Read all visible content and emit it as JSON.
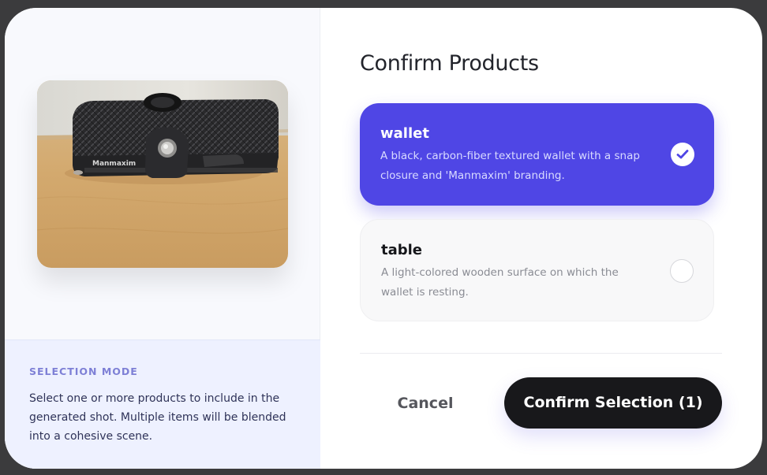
{
  "left": {
    "photo_brand_text": "Manmaxim",
    "mode_title": "SELECTION MODE",
    "mode_text": "Select one or more products to include in the generated shot. Multiple items will be blended into a cohesive scene."
  },
  "main": {
    "heading": "Confirm Products",
    "products": [
      {
        "name": "wallet",
        "description": "A black, carbon-fiber textured wallet with a snap closure and 'Manmaxim' branding.",
        "selected": true
      },
      {
        "name": "table",
        "description": "A light-colored wooden surface on which the wallet is resting.",
        "selected": false
      }
    ],
    "cancel_label": "Cancel",
    "confirm_label": "Confirm Selection (1)"
  },
  "colors": {
    "accent": "#4f46e5",
    "confirm_button": "#18181b",
    "mode_panel": "#eef1ff"
  },
  "icons": {
    "selected_check": "check-icon",
    "unselected_check": "empty-circle-icon"
  }
}
